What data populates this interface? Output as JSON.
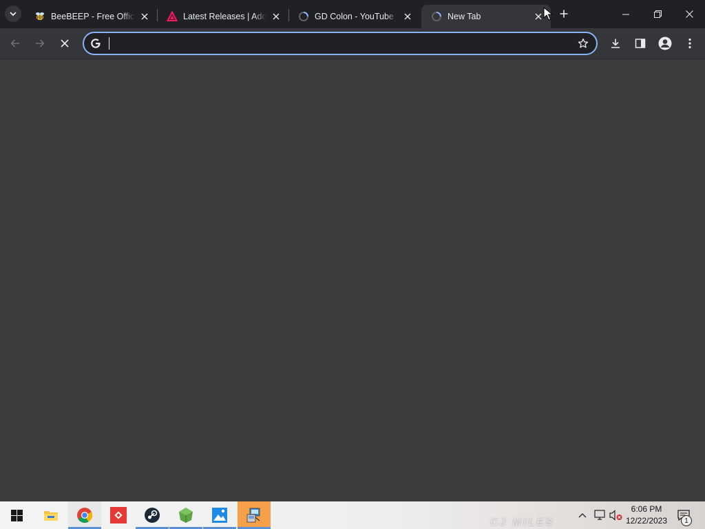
{
  "browser": {
    "tabs": [
      {
        "title": "BeeBEEP - Free Office Messenger",
        "favicon": "bee-icon",
        "active": false
      },
      {
        "title": "Latest Releases | Adoptium",
        "favicon": "adoptium-icon",
        "active": false
      },
      {
        "title": "GD Colon - YouTube",
        "favicon": "loading-spinner-icon",
        "active": false
      },
      {
        "title": "New Tab",
        "favicon": "loading-spinner-icon",
        "active": true
      }
    ],
    "omnibox": {
      "value": "",
      "placeholder": ""
    }
  },
  "taskbar": {
    "apps": [
      "windows-start-icon",
      "file-explorer-icon",
      "chrome-icon",
      "anydesk-icon",
      "steam-icon",
      "minecraft-icon",
      "image-viewer-icon",
      "app-installer-icon"
    ],
    "clock": {
      "time": "6:06 PM",
      "date": "12/22/2023"
    },
    "notification_count": "1",
    "wallpaper_text": "CJ MILES"
  },
  "colors": {
    "tabstrip": "#202124",
    "toolbar": "#35363a",
    "content": "#3c3c3c",
    "focus_ring": "#8ab4f8",
    "taskbar_highlight": "#f7a04a"
  }
}
